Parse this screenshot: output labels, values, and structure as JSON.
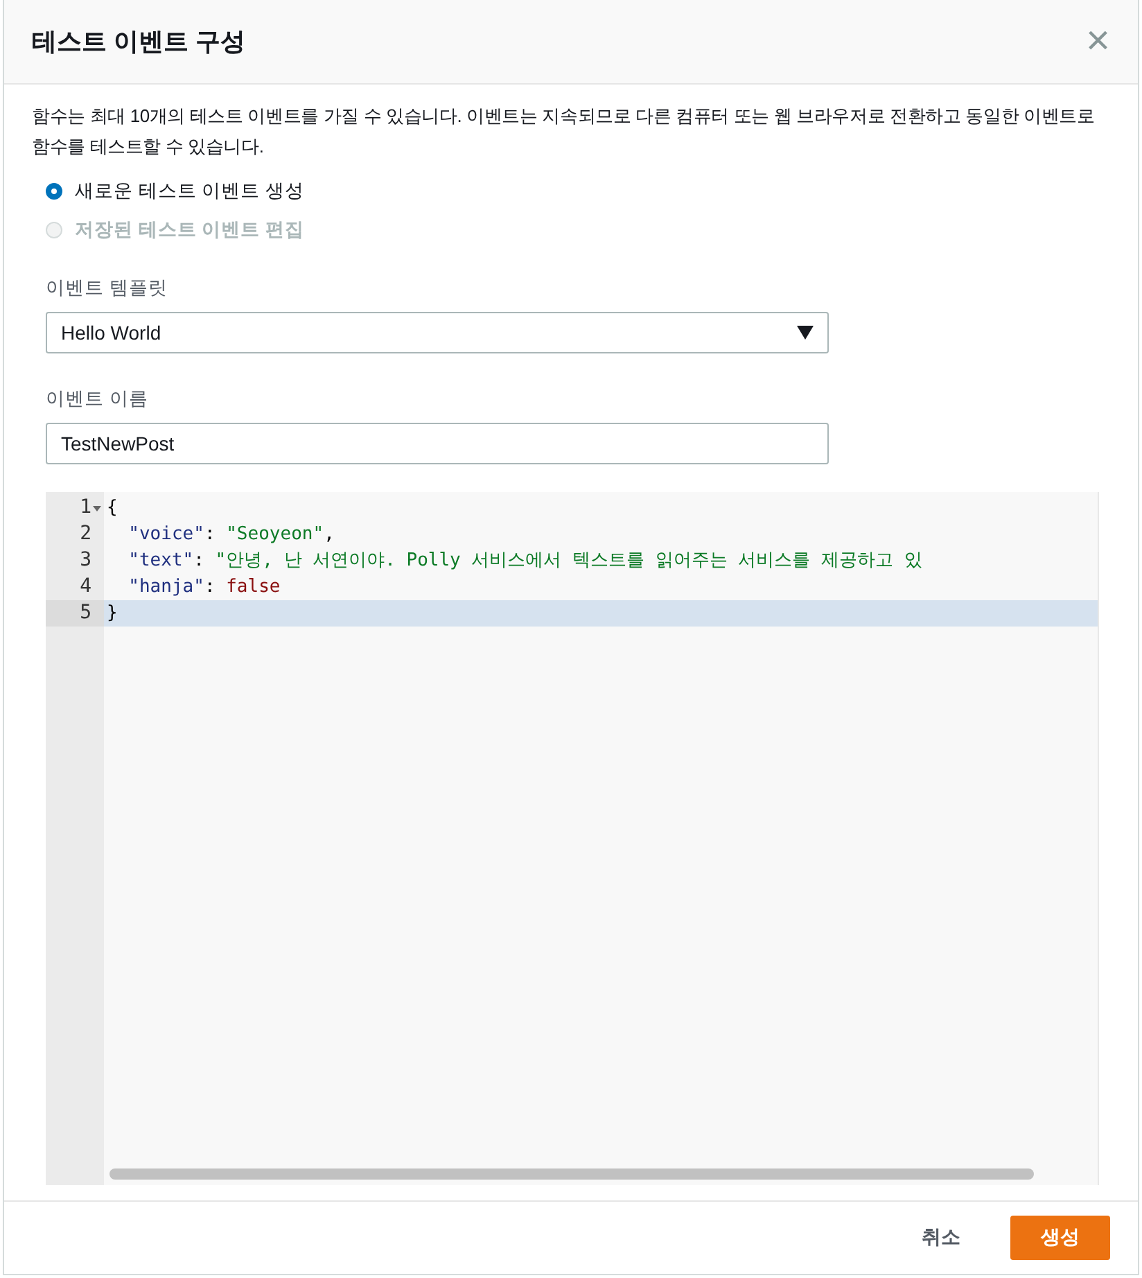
{
  "dialog": {
    "title": "테스트 이벤트 구성",
    "close": "×"
  },
  "description": "함수는 최대 10개의 테스트 이벤트를 가질 수 있습니다. 이벤트는 지속되므로 다른 컴퓨터 또는 웹 브라우저로 전환하고 동일한 이벤트로 함수를 테스트할 수 있습니다.",
  "options": [
    {
      "label": "새로운 테스트 이벤트 생성",
      "selected": true,
      "disabled": false
    },
    {
      "label": "저장된 테스트 이벤트 편집",
      "selected": false,
      "disabled": true
    }
  ],
  "template": {
    "label": "이벤트 템플릿",
    "value": "Hello World"
  },
  "event_name": {
    "label": "이벤트 이름",
    "value": "TestNewPost"
  },
  "editor": {
    "lines": [
      {
        "number": "1",
        "foldable": true,
        "selected": false,
        "tokens": [
          {
            "kind": "punct",
            "text": "{"
          }
        ]
      },
      {
        "number": "2",
        "foldable": false,
        "selected": false,
        "tokens": [
          {
            "kind": "key",
            "text": "  \"voice\""
          },
          {
            "kind": "punct",
            "text": ": "
          },
          {
            "kind": "string",
            "text": "\"Seoyeon\""
          },
          {
            "kind": "punct",
            "text": ","
          }
        ]
      },
      {
        "number": "3",
        "foldable": false,
        "selected": false,
        "tokens": [
          {
            "kind": "key",
            "text": "  \"text\""
          },
          {
            "kind": "punct",
            "text": ": "
          },
          {
            "kind": "string",
            "text": "\"안녕, 난 서연이야. Polly 서비스에서 텍스트를 읽어주는 서비스를 제공하고 있"
          }
        ]
      },
      {
        "number": "4",
        "foldable": false,
        "selected": false,
        "tokens": [
          {
            "kind": "key",
            "text": "  \"hanja\""
          },
          {
            "kind": "punct",
            "text": ": "
          },
          {
            "kind": "literal",
            "text": "false"
          }
        ]
      },
      {
        "number": "5",
        "foldable": false,
        "selected": true,
        "tokens": [
          {
            "kind": "punct",
            "text": "}"
          }
        ]
      }
    ]
  },
  "buttons": [
    {
      "label": "취소",
      "kind": "link"
    },
    {
      "label": "생성",
      "kind": "primary"
    }
  ]
}
